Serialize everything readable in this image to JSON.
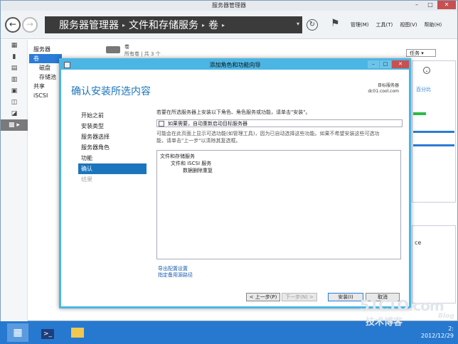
{
  "window": {
    "title": "服务器管理器",
    "controls": [
      "–",
      "□",
      "✕"
    ]
  },
  "navbar": {
    "back_icon": "back-arrow-icon",
    "breadcrumb": [
      "服务器管理器",
      "文件和存储服务",
      "卷"
    ],
    "menus": [
      "管理(M)",
      "工具(T)",
      "视图(V)",
      "帮助(H)"
    ]
  },
  "left_rail": {
    "icons": [
      "dashboard-icon",
      "local-server-icon",
      "all-servers-icon",
      "file-storage-icon",
      "iis-icon",
      "roles-icon",
      "tools-icon",
      "storage-icon"
    ]
  },
  "sub_nav": {
    "items": [
      "服务器",
      "卷",
      "磁盘",
      "存储池",
      "共享",
      "iSCSI"
    ]
  },
  "background": {
    "volumes_title": "卷",
    "volumes_subtitle": "所有卷 | 共 3 个",
    "tasks_label": "任务",
    "right_link_text": "百分比",
    "right_panel_text": "ce"
  },
  "wizard": {
    "title": "添加角色和功能向导",
    "heading": "确认安装所选内容",
    "target_label": "目标服务器",
    "target_server": "dc01.cool.com",
    "steps": [
      {
        "label": "开始之前",
        "state": "normal"
      },
      {
        "label": "安装类型",
        "state": "normal"
      },
      {
        "label": "服务器选择",
        "state": "normal"
      },
      {
        "label": "服务器角色",
        "state": "normal"
      },
      {
        "label": "功能",
        "state": "normal"
      },
      {
        "label": "确认",
        "state": "current"
      },
      {
        "label": "结果",
        "state": "disabled"
      }
    ],
    "info_text": "若要在所选服务器上安装以下角色、角色服务或功能，请单击\"安装\"。",
    "restart_checkbox_label": "如果需要，自动重新启动目标服务器",
    "restart_checked": false,
    "note_line1": "可能会在此页面上显示可选功能(如管理工具)，因为已自动选择这些功能。如果不希望安装这些可选功",
    "note_line2": "能，请单击\"上一步\"以清除其复选框。",
    "features": [
      {
        "label": "文件和存储服务",
        "level": 0
      },
      {
        "label": "文件和 iSCSI 服务",
        "level": 1
      },
      {
        "label": "数据删除重复",
        "level": 2
      }
    ],
    "links": [
      "导出配置设置",
      "指定备用源路径"
    ],
    "buttons": {
      "prev": "< 上一步(P)",
      "next": "下一步(N) >",
      "install": "安装(I)",
      "cancel": "取消"
    }
  },
  "taskbar": {
    "clock_time": "2:",
    "clock_date": "2012/12/29"
  },
  "watermark": {
    "main": "51CTO.com",
    "sub": "技术博客",
    "blog": "Blog"
  }
}
